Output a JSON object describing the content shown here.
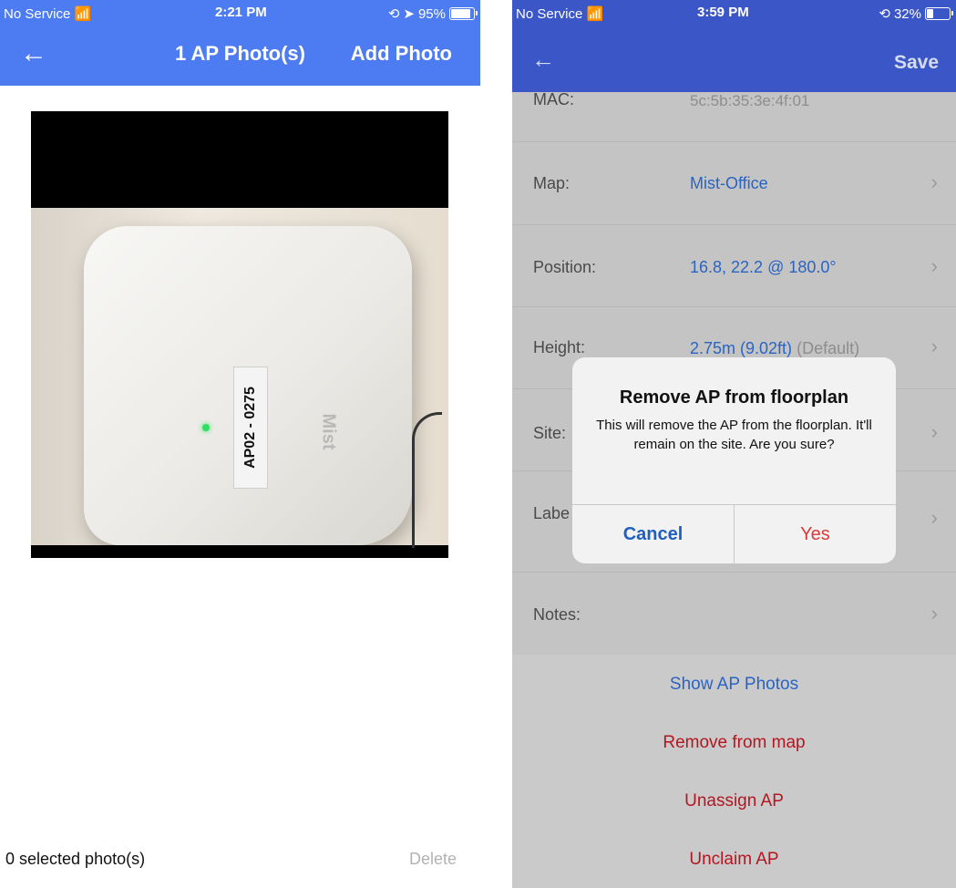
{
  "left": {
    "status": {
      "carrier": "No Service",
      "time": "2:21 PM",
      "battery": "95%",
      "battery_level": 0.95
    },
    "nav": {
      "title": "1 AP Photo(s)",
      "add_label": "Add Photo"
    },
    "photo": {
      "label_text": "AP02 - 0275",
      "brand_text": "Mist"
    },
    "footer": {
      "selected": "0 selected photo(s)",
      "delete": "Delete"
    }
  },
  "right": {
    "status": {
      "carrier": "No Service",
      "time": "3:59 PM",
      "battery": "32%",
      "battery_level": 0.32
    },
    "nav": {
      "save_label": "Save"
    },
    "rows": [
      {
        "key": "MAC:",
        "value": "5c:5b:35:3e:4f:01"
      },
      {
        "key": "Map:",
        "value": "Mist-Office"
      },
      {
        "key": "Position:",
        "value": "16.8, 22.2 @ 180.0°"
      },
      {
        "key": "Height:",
        "value": "2.75m (9.02ft)",
        "suffix": "(Default)"
      },
      {
        "key": "Site:",
        "value": ""
      },
      {
        "key": "Labe",
        "value": ""
      },
      {
        "key": "Notes:",
        "value": ""
      }
    ],
    "actions": {
      "show_photos": "Show AP Photos",
      "remove_map": "Remove from map",
      "unassign": "Unassign AP",
      "unclaim": "Unclaim AP"
    },
    "dialog": {
      "title": "Remove AP from floorplan",
      "message": "This will remove the AP from the floorplan. It'll remain on the site. Are you sure?",
      "cancel": "Cancel",
      "yes": "Yes"
    }
  },
  "colors": {
    "nav_blue_left": "#4d7cf2",
    "nav_blue_right": "#3b56c6",
    "link_blue": "#2a64c2",
    "danger_red": "#b41620"
  }
}
